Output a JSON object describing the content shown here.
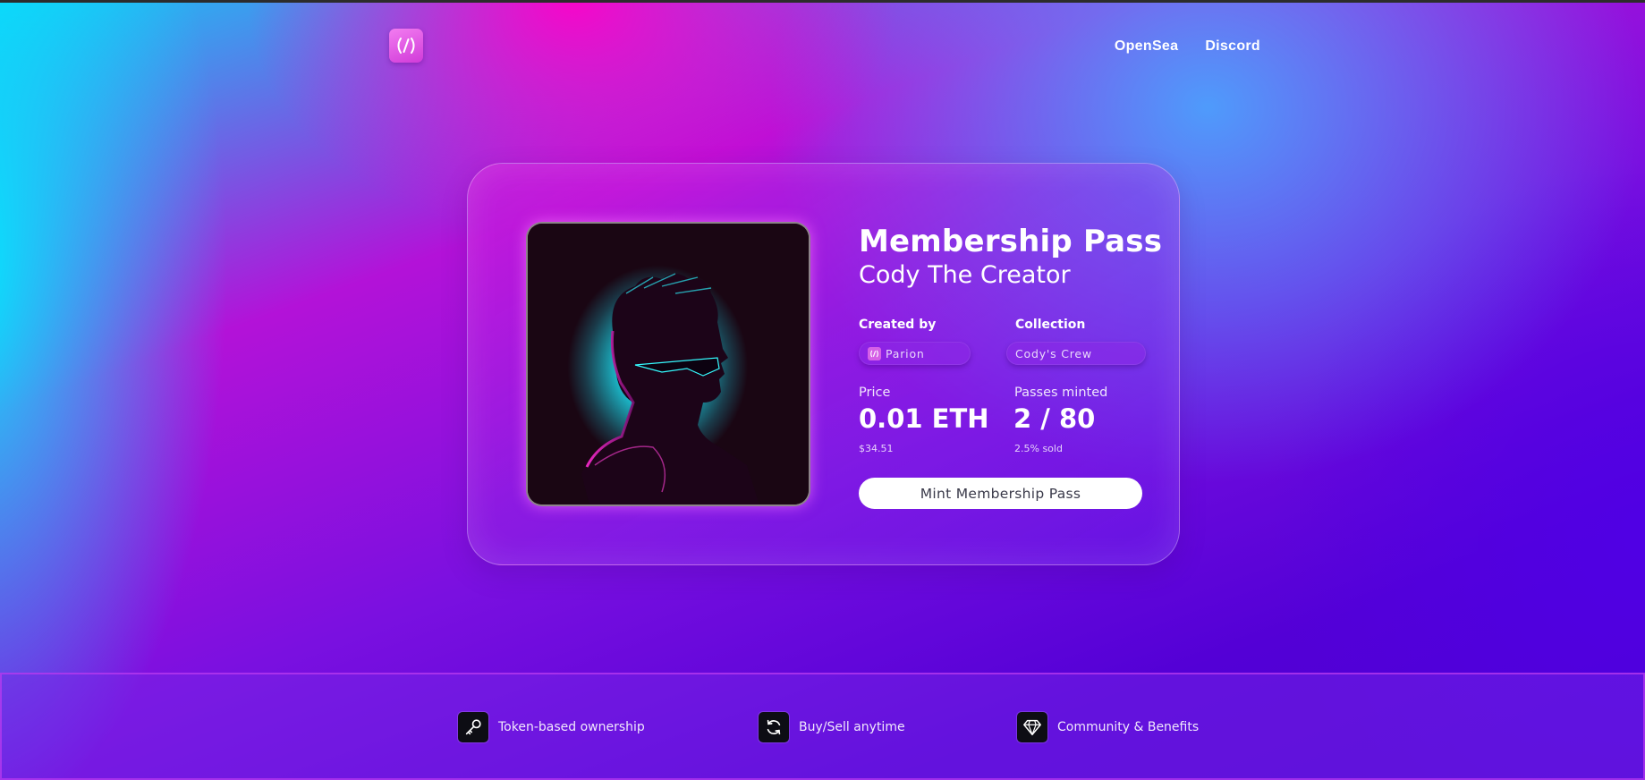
{
  "header": {
    "logo_glyph": "(/)",
    "nav": [
      {
        "label": "OpenSea"
      },
      {
        "label": "Discord"
      }
    ]
  },
  "card": {
    "title": "Membership Pass",
    "subtitle": "Cody The Creator",
    "created_by": {
      "label": "Created by",
      "value": "Parion",
      "icon": "code-logo-icon"
    },
    "collection": {
      "label": "Collection",
      "value": "Cody's Crew"
    },
    "price": {
      "label": "Price",
      "value": "0.01 ETH",
      "sub": "$34.51"
    },
    "minted": {
      "label": "Passes minted",
      "value": "2 / 80",
      "sub": "2.5% sold"
    },
    "mint_button": "Mint Membership Pass"
  },
  "features": [
    {
      "icon": "key-icon",
      "label": "Token-based ownership"
    },
    {
      "icon": "refresh-icon",
      "label": "Buy/Sell anytime"
    },
    {
      "icon": "diamond-icon",
      "label": "Community & Benefits"
    }
  ],
  "colors": {
    "accent_pink": "#ff00c8",
    "accent_cyan": "#00ebff",
    "accent_violet": "#5300d6",
    "button_bg": "#ffffff"
  }
}
